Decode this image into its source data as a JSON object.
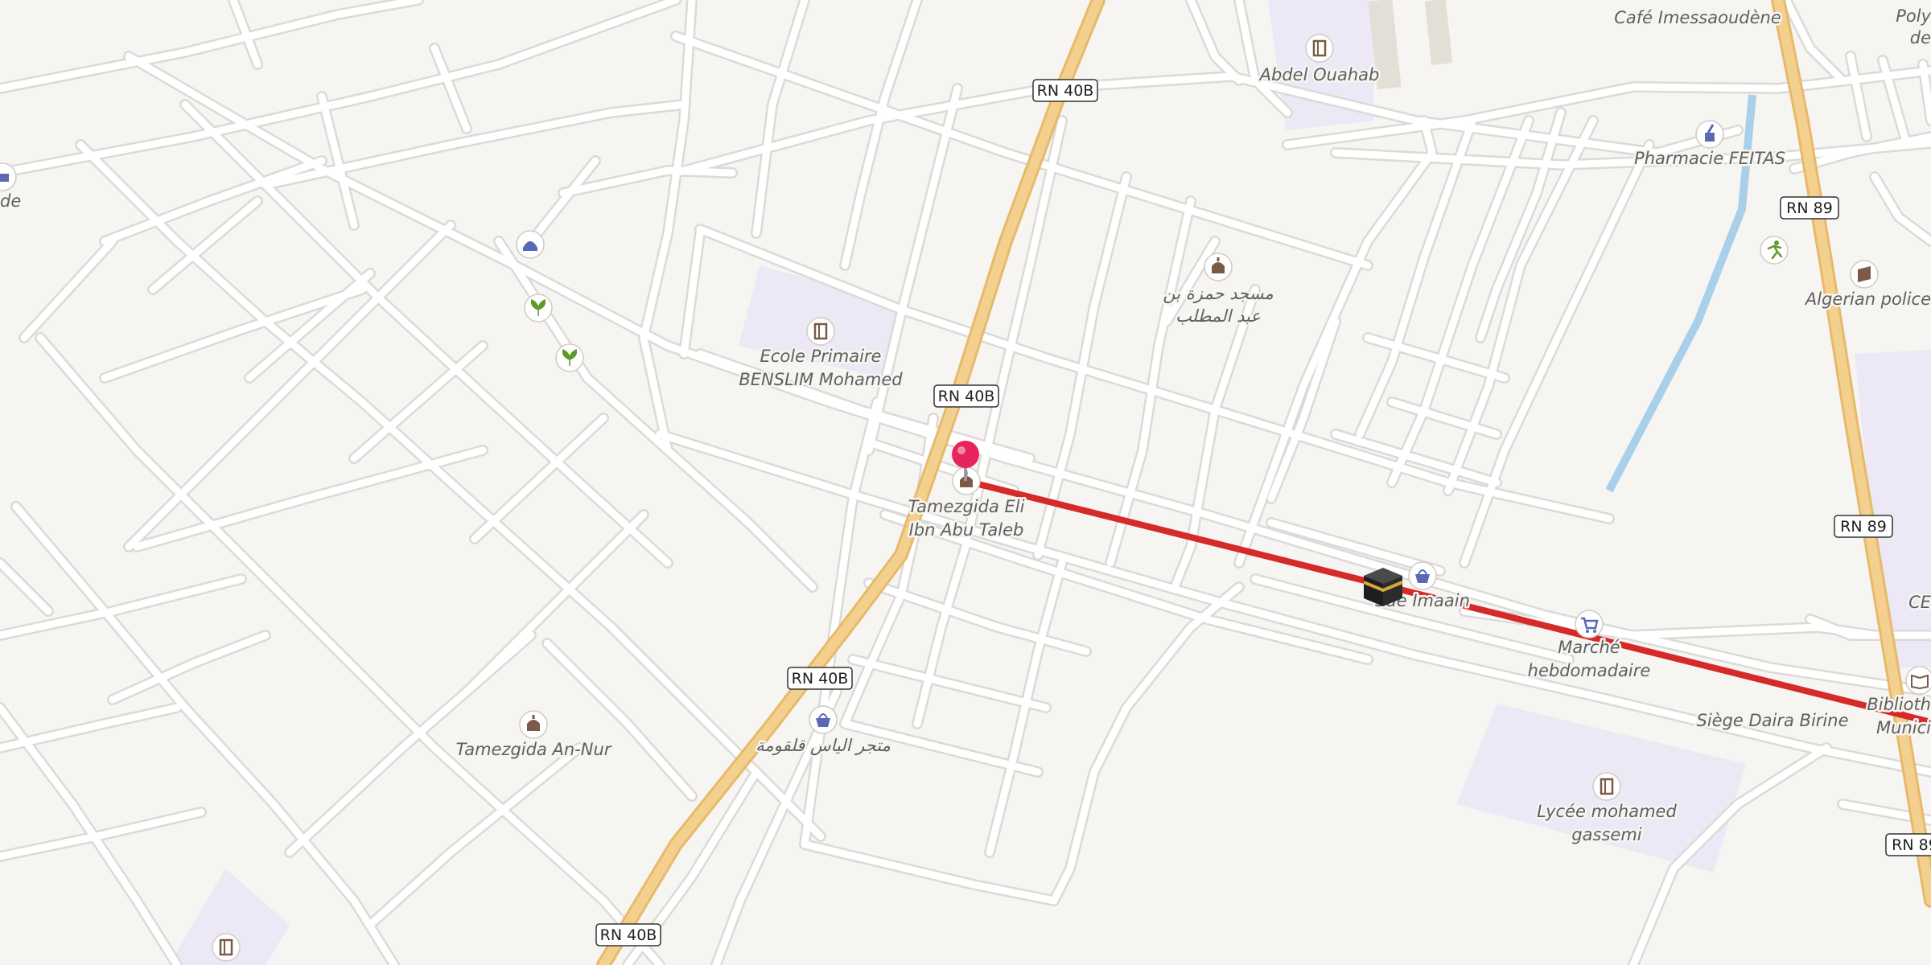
{
  "colors": {
    "background": "#f7f5f1",
    "street": "#ffffff",
    "street_casing": "#dcdad7",
    "primary_road": "#f4d08e",
    "primary_road_casing": "#e7b96d",
    "school_area": "#ece8f6",
    "water": "#a9d0ea",
    "route_line": "#d62a2a",
    "pin": "#e8245d",
    "poi_blue": "#5a68b6",
    "poi_brown": "#7b5b47",
    "poi_green": "#5d9a2b"
  },
  "roads": {
    "shields": [
      "RN 40B",
      "RN 40B",
      "RN 40B",
      "RN 40B",
      "RN 89",
      "RN 89",
      "RN 89"
    ]
  },
  "labels": {
    "abdel_ouahab": "Abdel Ouahab",
    "cafe": "Café Imessaoudène",
    "poly_line1": "Poly",
    "poly_line2": "de",
    "pharmacie": "Pharmacie FEITAS",
    "algerian_police": "Algerian police",
    "mosque_hamza_line1": "مسجد حمزة بن",
    "mosque_hamza_line2": "عبد المطلب",
    "ecole_line1": "Ecole Primaire",
    "ecole_line2": "BENSLIM Mohamed",
    "tamezgida_ali_line1": "Tamezgida Eli",
    "tamezgida_ali_line2": "Ibn Abu Taleb",
    "superette": "Sde Imaain",
    "marche_line1": "Marché",
    "marche_line2": "hebdomadaire",
    "siege_daira": "Siège Daira Birine",
    "bibliotheque_line1": "Biblioth",
    "bibliotheque_line2": "Munici",
    "ce": "CE",
    "lycee_line1": "Lycée mohamed",
    "lycee_line2": "gassemi",
    "tamezgida_nur": "Tamezgida An-Nur",
    "shop_ilyas": "متجر الياس قلقومة",
    "left_edge": "de"
  },
  "icons": {
    "pin": "location-pin-icon",
    "kaaba": "kaaba-icon",
    "school": "school-icon",
    "mosque": "mosque-icon",
    "shop": "shopping-basket-icon",
    "cart": "shopping-cart-icon",
    "pharmacy": "pharmacy-icon",
    "police": "police-icon",
    "sport": "running-icon",
    "garden": "plant-icon",
    "library": "library-icon",
    "playground": "playground-icon"
  }
}
